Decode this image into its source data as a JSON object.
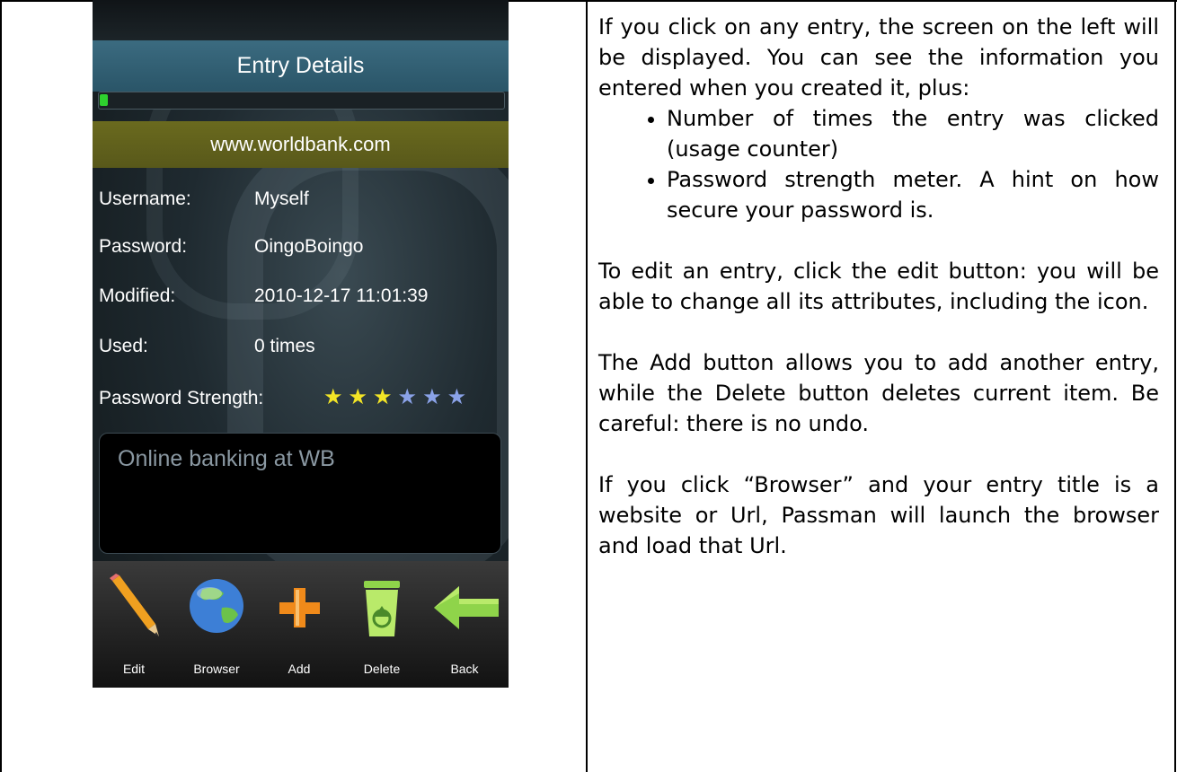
{
  "phone": {
    "title": "Entry Details",
    "progress": 0.02,
    "url": "www.worldbank.com",
    "fields": [
      {
        "label": "Username:",
        "value": "Myself"
      },
      {
        "label": "Password:",
        "value": "OingoBoingo"
      },
      {
        "label": "Modified:",
        "value": "2010-12-17 11:01:39"
      },
      {
        "label": "Used:",
        "value": "0 times"
      }
    ],
    "strength_label": "Password Strength:",
    "strength_rating": 3,
    "strength_max": 6,
    "notes": "Online banking at WB",
    "toolbar": [
      {
        "label": "Edit",
        "icon": "pencil-icon"
      },
      {
        "label": "Browser",
        "icon": "globe-icon"
      },
      {
        "label": "Add",
        "icon": "plus-icon"
      },
      {
        "label": "Delete",
        "icon": "recycle-bin-icon"
      },
      {
        "label": "Back",
        "icon": "back-arrow-icon"
      }
    ],
    "colors": {
      "star_on": "#f3e526",
      "star_off": "#8aa2e8",
      "progress": "#2ed12e",
      "title_bar": "#2f5f74",
      "url_bar": "#62621c"
    }
  },
  "text": {
    "intro": "If you click on any entry, the screen on the left will be displayed. You can see the information you entered when you created it, plus:",
    "bullets": [
      "Number of times the entry was clicked (usage counter)",
      "Password strength meter. A hint on how secure your password is."
    ],
    "edit": "To edit an entry, click the edit button: you will be able to change all its attributes, including the icon.",
    "add_delete": "The Add button allows you to add another entry, while the Delete button deletes current item. Be careful: there is no undo.",
    "browser": "If you click “Browser” and your entry title is a website or Url, Passman will launch the browser and load that Url."
  }
}
